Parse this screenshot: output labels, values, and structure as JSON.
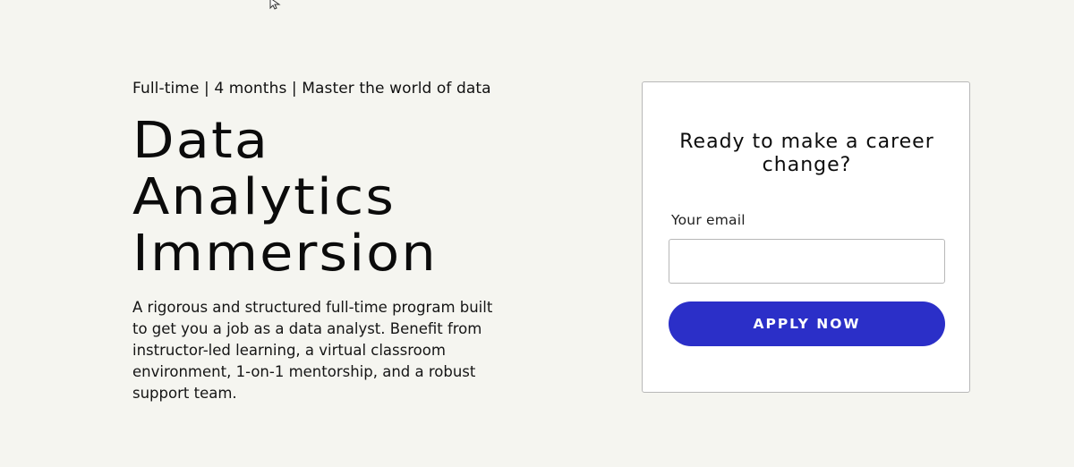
{
  "hero": {
    "subheading": "Full-time | 4 months | Master the world of data",
    "title_lines": [
      "Data",
      "Analytics",
      "Immersion"
    ],
    "description": "A rigorous and structured full-time program built to get you a job as a data analyst. Benefit from instructor-led learning, a virtual classroom environment, 1-on-1 mentorship, and a robust support team."
  },
  "card": {
    "title": "Ready to make a career change?",
    "email_label": "Your email",
    "email_value": "",
    "apply_button_label": "APPLY NOW"
  },
  "colors": {
    "background": "#f5f5f0",
    "card_background": "#ffffff",
    "card_border": "#b8b8b8",
    "primary_button": "#2b2fc8",
    "text": "#111111"
  },
  "icons": {
    "cursor": "mouse-pointer-icon"
  }
}
